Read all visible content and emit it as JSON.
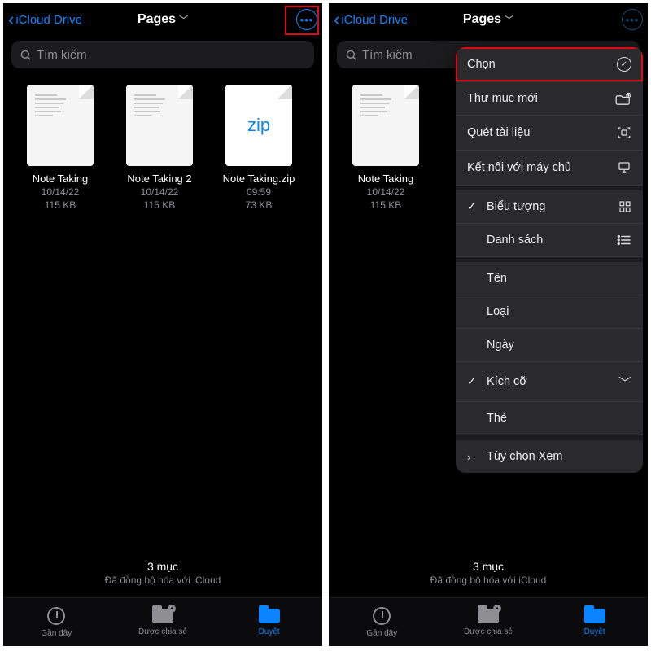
{
  "header": {
    "back_label": "iCloud Drive",
    "title": "Pages"
  },
  "search": {
    "placeholder": "Tìm kiếm"
  },
  "files": [
    {
      "name": "Note Taking",
      "date": "10/14/22",
      "size": "115 KB",
      "kind": "doc"
    },
    {
      "name": "Note Taking 2",
      "date": "10/14/22",
      "size": "115 KB",
      "kind": "doc"
    },
    {
      "name": "Note Taking.zip",
      "date": "09:59",
      "size": "73 KB",
      "kind": "zip"
    }
  ],
  "status": {
    "count": "3 mục",
    "sync": "Đã đồng bộ hóa với iCloud"
  },
  "tabs": {
    "recent": "Gần đây",
    "shared": "Được chia sẻ",
    "browse": "Duyệt"
  },
  "menu": {
    "select": "Chọn",
    "new_folder": "Thư mục mới",
    "scan_doc": "Quét tài liệu",
    "connect_server": "Kết nối với máy chủ",
    "icons": "Biểu tượng",
    "list": "Danh sách",
    "sort_name": "Tên",
    "sort_kind": "Loại",
    "sort_date": "Ngày",
    "sort_size": "Kích cỡ",
    "sort_tags": "Thẻ",
    "view_options": "Tùy chọn Xem"
  },
  "left_panel_files_visible": [
    0,
    1,
    2
  ],
  "right_panel_files_visible": [
    0
  ]
}
